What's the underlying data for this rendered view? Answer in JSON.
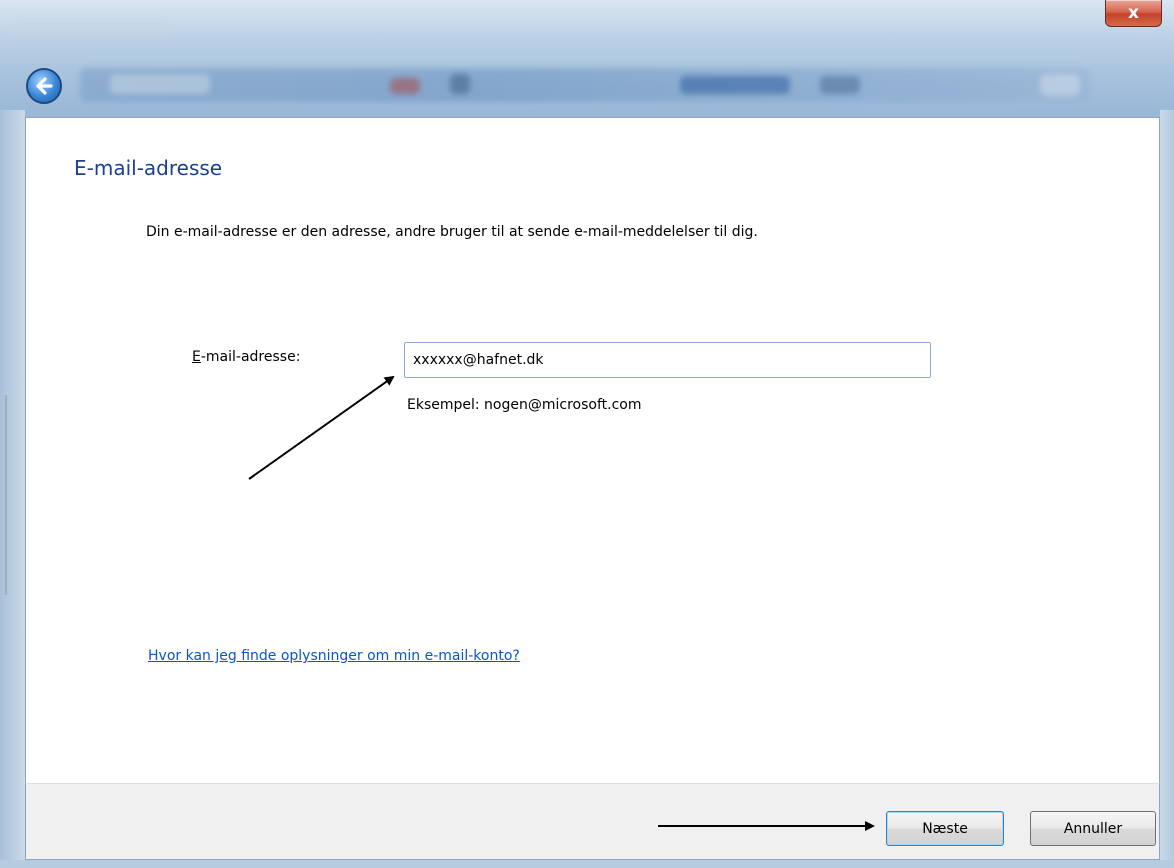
{
  "window": {
    "close_glyph": "x"
  },
  "page": {
    "title": "E-mail-adresse",
    "description": "Din e-mail-adresse er den adresse, andre bruger til at sende e-mail-meddelelser til dig."
  },
  "form": {
    "email_label_mnemonic": "E",
    "email_label_rest": "-mail-adresse:",
    "email_value": "xxxxxx@hafnet.dk",
    "example": "Eksempel: nogen@microsoft.com"
  },
  "help": {
    "link_text": "Hvor kan jeg finde oplysninger om min e-mail-konto?"
  },
  "buttons": {
    "next": "Næste",
    "cancel": "Annuller"
  },
  "icons": {
    "back": "back-arrow-icon",
    "close": "close-icon"
  },
  "colors": {
    "title": "#1e3f8f",
    "link": "#0a55c9",
    "close_button": "#c2432b"
  }
}
